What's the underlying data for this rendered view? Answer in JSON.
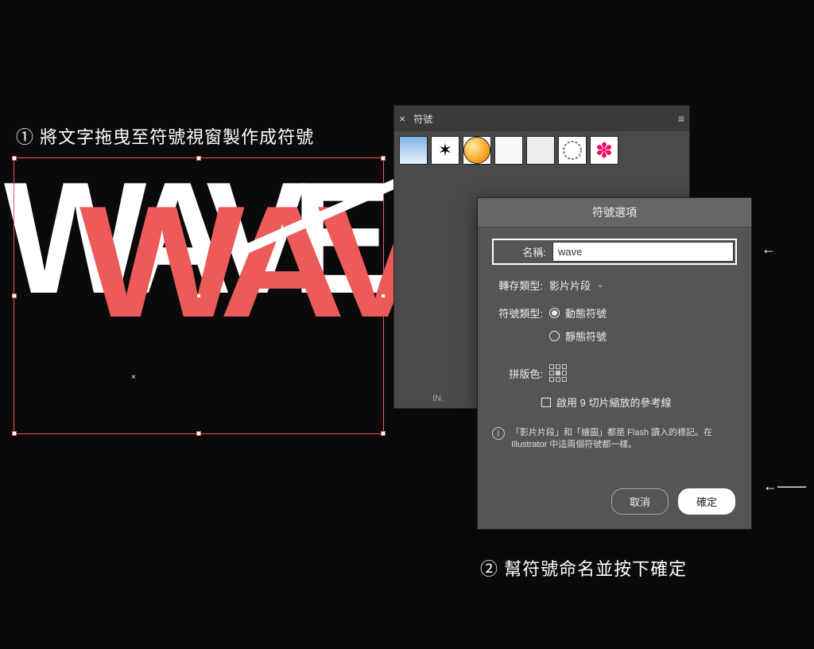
{
  "instructions": {
    "step1": "① 將文字拖曳至符號視窗製作成符號",
    "step2": "② 幫符號命名並按下確定"
  },
  "canvas": {
    "text_white": "WAVE",
    "text_red": "WAVE"
  },
  "symbols_panel": {
    "title": "符號",
    "bottom_label": "IN.",
    "swatches": [
      "gradient",
      "splatter",
      "orange",
      "light",
      "box",
      "ring",
      "flower"
    ]
  },
  "dialog": {
    "title": "符號選項",
    "name_label": "名稱:",
    "name_value": "wave",
    "export_type_label": "轉存類型:",
    "export_type_value": "影片片段",
    "symbol_type_label": "符號類型:",
    "symbol_type_dynamic": "動態符號",
    "symbol_type_static": "靜態符號",
    "registration_label": "拼版色:",
    "slice_guides": "啟用 9 切片縮放的參考線",
    "info_text": "「影片片段」和「繪圖」都是 Flash 讀入的標記。在 Illustrator 中這兩個符號都一樣。",
    "cancel": "取消",
    "ok": "確定"
  }
}
